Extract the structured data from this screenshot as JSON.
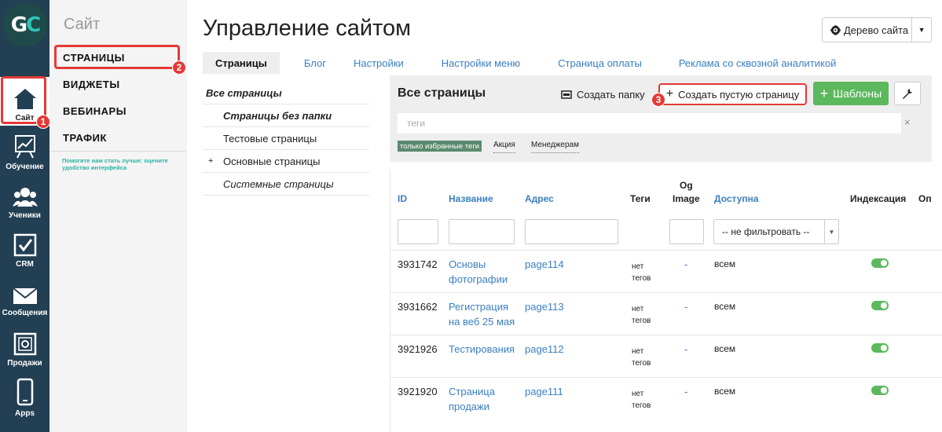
{
  "logo": {
    "g": "G",
    "c": "C"
  },
  "rail": {
    "items": [
      {
        "label": "Сайт",
        "icon": "home-icon"
      },
      {
        "label": "Обучение",
        "icon": "chart-board-icon"
      },
      {
        "label": "Ученики",
        "icon": "users-icon"
      },
      {
        "label": "CRM",
        "icon": "checkbox-icon"
      },
      {
        "label": "Сообщения",
        "icon": "envelope-icon"
      },
      {
        "label": "Продажи",
        "icon": "safe-icon"
      },
      {
        "label": "Apps",
        "icon": "phone-icon"
      }
    ]
  },
  "badges": {
    "one": "1",
    "two": "2",
    "three": "3"
  },
  "subnav": {
    "title": "Сайт",
    "items": [
      "СТРАНИЦЫ",
      "ВИДЖЕТЫ",
      "ВЕБИНАРЫ",
      "ТРАФИК"
    ],
    "help": "Помогите нам стать лучше: оцените удобство интерфейса"
  },
  "header": {
    "title": "Управление сайтом",
    "tree_button": "Дерево сайта"
  },
  "tabs": [
    "Страницы",
    "Блог",
    "Настройки",
    "Настройки меню",
    "Страница оплаты",
    "Реклама со сквозной аналитикой"
  ],
  "folders": {
    "all": "Все страницы",
    "no_folder": "Страницы без папки",
    "test": "Тестовые страницы",
    "main_plus": "+",
    "main": "Основные страницы",
    "system": "Системные страницы"
  },
  "panel": {
    "title": "Все страницы",
    "create_folder": "Создать папку",
    "create_page_plus": "+",
    "create_page": "Создать пустую страницу",
    "templates": "Шаблоны",
    "templates_plus": "+",
    "tags_placeholder": "теги",
    "clear": "×",
    "tags": [
      "только избранные теги",
      "Акция",
      "Менеджерам"
    ]
  },
  "table": {
    "headers": {
      "id": "ID",
      "name": "Название",
      "address": "Адрес",
      "tags": "Теги",
      "og1": "Og",
      "og2": "Image",
      "available": "Доступна",
      "indexing": "Индексация",
      "cut": "Оп"
    },
    "filter_select": "-- не фильтровать --",
    "rows": [
      {
        "id": "3931742",
        "name1": "Основы",
        "name2": "фотографии",
        "address": "page114",
        "tags1": "нет",
        "tags2": "тегов",
        "og": "-",
        "available": "всем",
        "indexed": true
      },
      {
        "id": "3931662",
        "name1": "Регистрация",
        "name2": "на веб 25 мая",
        "address": "page113",
        "tags1": "нет",
        "tags2": "тегов",
        "og": "-",
        "available": "всем",
        "indexed": true
      },
      {
        "id": "3921926",
        "name1": "Тестирования",
        "name2": "",
        "address": "page112",
        "tags1": "нет",
        "tags2": "тегов",
        "og": "-",
        "available": "всем",
        "indexed": true
      },
      {
        "id": "3921920",
        "name1": "Страница",
        "name2": "продажи",
        "address": "page111",
        "tags1": "нет",
        "tags2": "тегов",
        "og": "-",
        "available": "всем",
        "indexed": true
      }
    ]
  },
  "colors": {
    "highlight": "#e53935",
    "rail": "#223f53",
    "link": "#3a7fc1",
    "success": "#5cb85c"
  }
}
